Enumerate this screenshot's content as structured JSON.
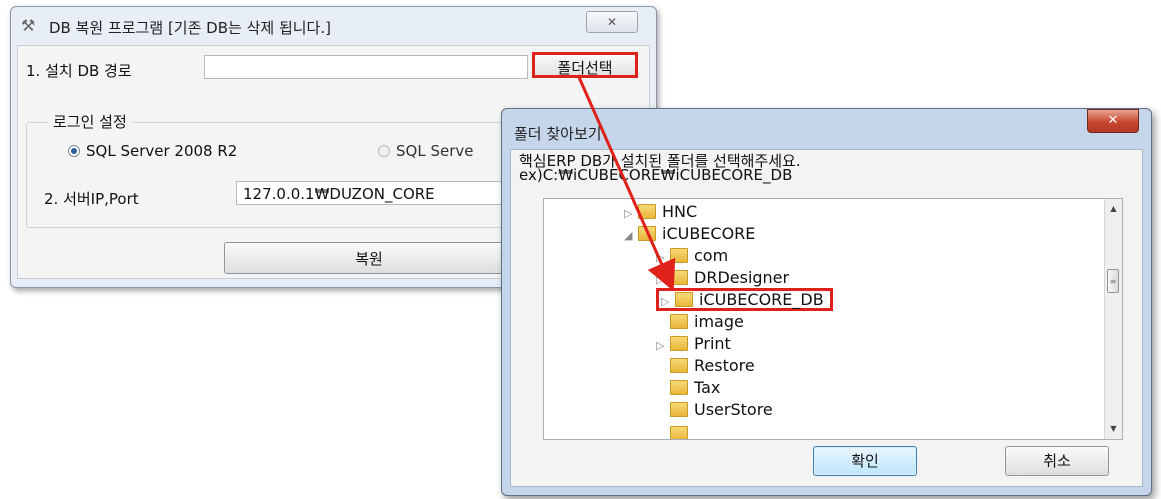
{
  "restore_window": {
    "title": "DB 복원 프로그램 [기존 DB는 삭제 됩니다.]",
    "close_glyph": "✕",
    "path_label": "1. 설치 DB 경로",
    "path_value": "",
    "folder_button": "폴더선택",
    "login_group_title": "로그인 설정",
    "radio_options": [
      {
        "label": "SQL Server 2008 R2",
        "selected": true
      },
      {
        "label": "SQL Serve",
        "selected": false
      }
    ],
    "server_label": "2. 서버IP,Port",
    "server_value": "127.0.0.1₩DUZON_CORE",
    "restore_button": "복원"
  },
  "browse_dialog": {
    "title": "폴더 찾아보기",
    "close_glyph": "✕",
    "description_line1": "핵심ERP DB가 설치된 폴더를 선택해주세요.",
    "description_line2": "ex)C:₩iCUBECORE₩iCUBECORE_DB",
    "tree": [
      {
        "label": "HNC",
        "expander": "▷",
        "selected": false
      },
      {
        "label": "iCUBECORE",
        "expander": "◢",
        "selected": false
      },
      {
        "label": "com",
        "expander": "▷",
        "selected": false
      },
      {
        "label": "DRDesigner",
        "expander": "▷",
        "selected": false
      },
      {
        "label": "iCUBECORE_DB",
        "expander": "▷",
        "selected": true
      },
      {
        "label": "image",
        "expander": "",
        "selected": false
      },
      {
        "label": "Print",
        "expander": "▷",
        "selected": false
      },
      {
        "label": "Restore",
        "expander": "",
        "selected": false
      },
      {
        "label": "Tax",
        "expander": "",
        "selected": false
      },
      {
        "label": "UserStore",
        "expander": "",
        "selected": false
      }
    ],
    "ok_button": "확인",
    "cancel_button": "취소"
  },
  "colors": {
    "highlight": "#e0201a"
  }
}
